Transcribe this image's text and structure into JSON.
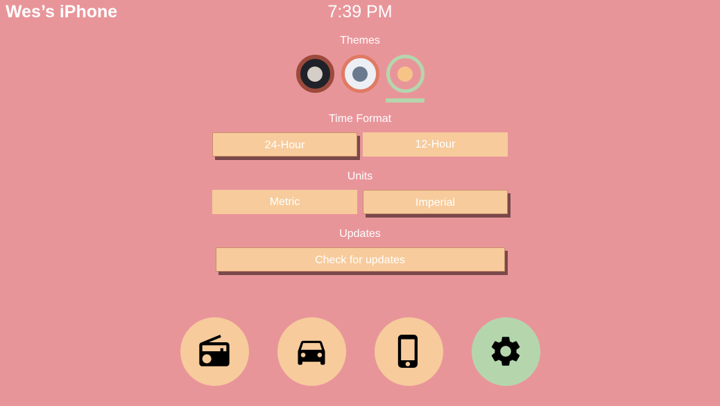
{
  "statusbar": {
    "device_title": "Wes’s iPhone",
    "clock": "7:39 PM"
  },
  "settings": {
    "themes": {
      "label": "Themes",
      "options": [
        {
          "name": "dark",
          "ring_color": "#9d4a3d",
          "fill_color": "#1f2228",
          "dot_color": "#d5cec6",
          "selected": false
        },
        {
          "name": "light",
          "ring_color": "#e07a63",
          "fill_color": "#eceff4",
          "dot_color": "#6b7a8f",
          "selected": false
        },
        {
          "name": "warm",
          "ring_color": "#b5d6ad",
          "fill_color": "transparent",
          "dot_color": "#f7c488",
          "selected": true
        }
      ]
    },
    "time_format": {
      "label": "Time Format",
      "options": [
        {
          "label": "24-Hour",
          "selected": true
        },
        {
          "label": "12-Hour",
          "selected": false
        }
      ]
    },
    "units": {
      "label": "Units",
      "options": [
        {
          "label": "Metric",
          "selected": false
        },
        {
          "label": "Imperial",
          "selected": true
        }
      ]
    },
    "updates": {
      "label": "Updates",
      "button_label": "Check for updates"
    }
  },
  "navbar": {
    "items": [
      {
        "icon": "radio-icon",
        "active": false
      },
      {
        "icon": "car-icon",
        "active": false
      },
      {
        "icon": "phone-icon",
        "active": false
      },
      {
        "icon": "settings-icon",
        "active": true
      }
    ]
  },
  "colors": {
    "background": "#e8959a",
    "button": "#f7cb9c",
    "accent_green": "#b5d6ad",
    "text": "#ffffff"
  }
}
